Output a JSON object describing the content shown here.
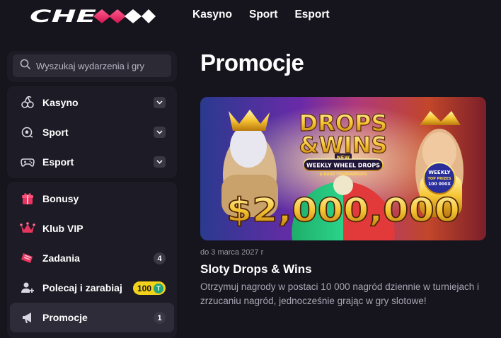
{
  "header": {
    "logo_text": "CHEXXX",
    "nav": [
      "Kasyno",
      "Sport",
      "Esport"
    ]
  },
  "sidebar": {
    "search_placeholder": "Wyszukaj wydarzenia i gry",
    "group1": [
      {
        "label": "Kasyno",
        "icon": "cherries-icon"
      },
      {
        "label": "Sport",
        "icon": "soccer-ball-icon"
      },
      {
        "label": "Esport",
        "icon": "gamepad-icon"
      }
    ],
    "group2": [
      {
        "label": "Bonusy",
        "icon": "gift-icon"
      },
      {
        "label": "Klub VIP",
        "icon": "crown-icon"
      },
      {
        "label": "Zadania",
        "icon": "ticket-icon",
        "count": "4"
      },
      {
        "label": "Polecaj i zarabiaj",
        "icon": "add-user-icon",
        "reward": "100",
        "reward_currency": "T"
      },
      {
        "label": "Promocje",
        "icon": "megaphone-icon",
        "count": "1",
        "active": true
      }
    ]
  },
  "main": {
    "title": "Promocje",
    "promo": {
      "banner": {
        "headline_line1": "DROPS",
        "headline_line2": "&WINS",
        "ribbon_new": "NEW",
        "ribbon_main": "WEEKLY WHEEL DROPS",
        "ribbon_sub": "& DAILY TOURNAMENTS",
        "seal_line1": "WEEKLY",
        "seal_line2": "TOP PRIZES",
        "seal_line3": "100 000X",
        "amount": "$2,000,000"
      },
      "date": "do 3 marca 2027 r",
      "title": "Sloty Drops & Wins",
      "description": "Otrzymuj nagrody w postaci 10 000 nagród dziennie w turniejach i zrzucaniu nagród, jednocześnie grając w gry slotowe!"
    }
  },
  "colors": {
    "background": "#16141d",
    "panel": "#1d1b25",
    "accent_pink": "#ff2e6d",
    "coin_yellow": "#f3d21b",
    "coin_green": "#22a57a"
  }
}
